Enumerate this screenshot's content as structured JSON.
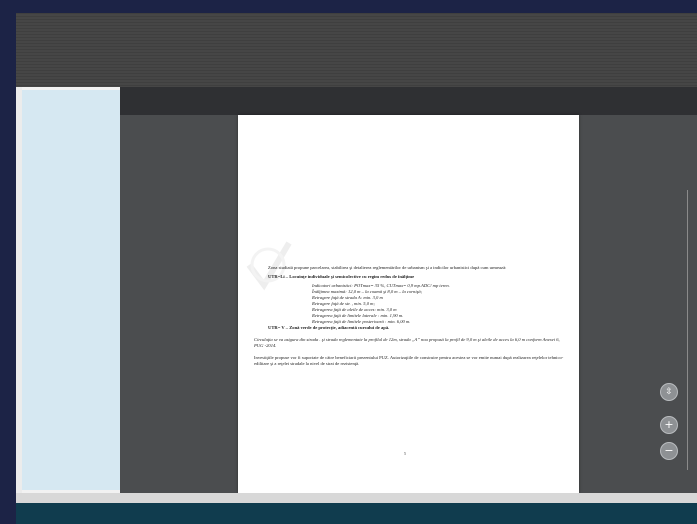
{
  "document": {
    "paragraph1": "Zona studiată propune parcelarea, stabilirea şi detalierea reglementărilor de urbanism şi a indicilor urbanistici după cum urmează:",
    "utr1": "UTR=Li – Locuinţe individuale şi semicolective cu regim redus de înălţime",
    "indicators": "Indicatori urbanistici: POTmax= 35 %, CUTmax= 0,9 mp.ADC/ mp teren.",
    "height": "Înălţimea maximă: 12,0 m – la coamă şi 8,0 m – la cornişă;",
    "setback_street_a": "Retragere faţă de strada A: min. 3,0 m",
    "setback_street": "Retragere faţă de str.        ,       min. 5,0 m;",
    "setback_access": "Retragerea faţă de aleile de acces: min. 3,0 m",
    "setback_side": "Retragerea faţă de limitele laterale : min. 1,90 m.",
    "setback_rear": "Retragerea faţă de limitele posterioară : min. 6,00 m.",
    "utr2": "UTR= V – Zonă verde de protecţie, adiacentă cursului de apă.",
    "circulation": "Circulaţia se va asigura din strada .               şi strada                           reglementate la profilul de 12m, strada „A” nou propusă  la profil de 9,0 m şi aleile de acces la 6,0 m conform Anexei 6, PUG -2014.",
    "investments": "Investiţiile propuse vor fi suportate de către beneficiarii prezentului PUZ. Autorizaţiile de construire pentru acestea se vor emite numai după realizarea reţelelor tehnico-edilitare şi a reţelei stradale la nivel de strat de rezistenţă.",
    "page_number": "5"
  },
  "controls": {
    "fit_label": "⇳",
    "zoom_in_label": "+",
    "zoom_out_label": "−"
  }
}
